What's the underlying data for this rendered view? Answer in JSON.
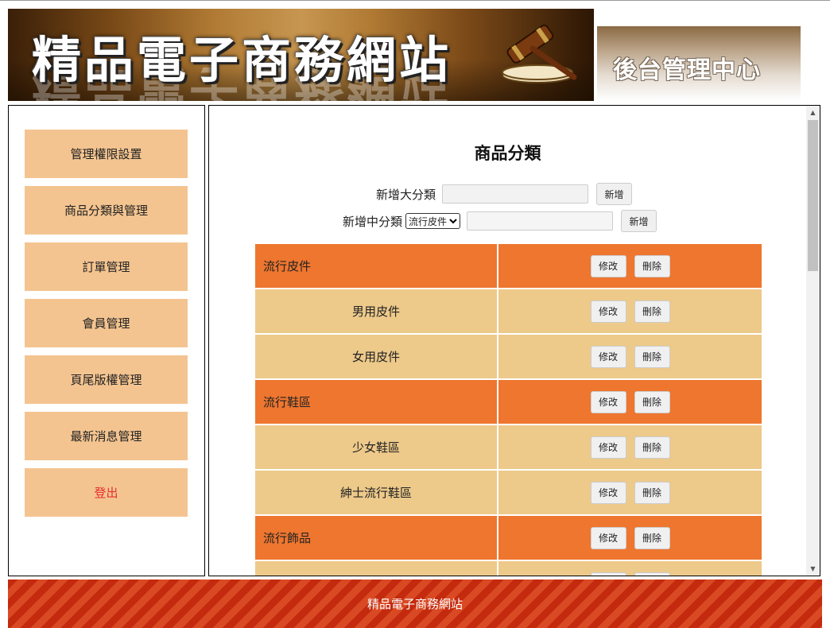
{
  "header": {
    "site_title": "精品電子商務網站",
    "admin_title": "後台管理中心"
  },
  "sidebar": {
    "items": [
      {
        "label": "管理權限設置"
      },
      {
        "label": "商品分類與管理"
      },
      {
        "label": "訂單管理"
      },
      {
        "label": "會員管理"
      },
      {
        "label": "頁尾版權管理"
      },
      {
        "label": "最新消息管理"
      },
      {
        "label": "登出"
      }
    ]
  },
  "main": {
    "title": "商品分類",
    "add_major": {
      "label": "新增大分類",
      "value": "",
      "button": "新增"
    },
    "add_minor": {
      "label": "新增中分類",
      "selected": "流行皮件",
      "value": "",
      "button": "新增"
    },
    "edit_label": "修改",
    "delete_label": "刪除",
    "categories": [
      {
        "name": "流行皮件",
        "level": "major"
      },
      {
        "name": "男用皮件",
        "level": "minor"
      },
      {
        "name": "女用皮件",
        "level": "minor"
      },
      {
        "name": "流行鞋區",
        "level": "major"
      },
      {
        "name": "少女鞋區",
        "level": "minor"
      },
      {
        "name": "紳士流行鞋區",
        "level": "minor"
      },
      {
        "name": "流行飾品",
        "level": "major"
      },
      {
        "name": "",
        "level": "minor"
      }
    ]
  },
  "footer": {
    "text": "精品電子商務網站"
  },
  "colors": {
    "major_row": "#ee762f",
    "minor_row": "#edc98a",
    "menu_button": "#f4c490",
    "logout_text": "#e53030",
    "footer": "#c42a0e"
  },
  "icons": [
    "gavel-icon",
    "scroll-up-icon",
    "scroll-down-icon",
    "dropdown-chevron-icon"
  ]
}
